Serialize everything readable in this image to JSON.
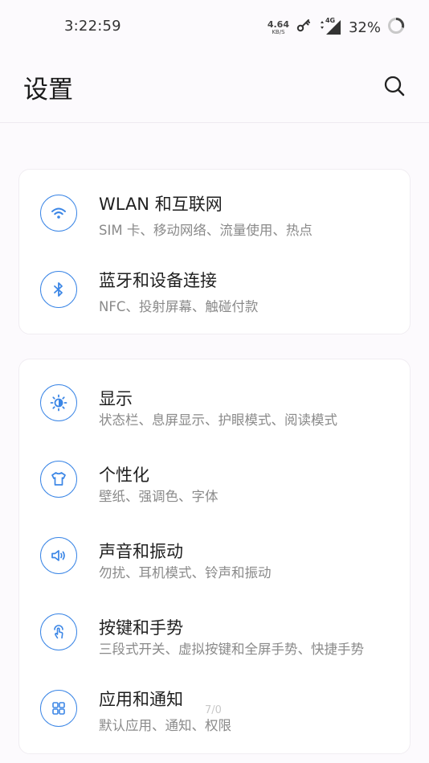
{
  "status_bar": {
    "time": "3:22:59",
    "net_speed_value": "4.64",
    "net_speed_unit": "KB/S",
    "network_type": "4G",
    "battery_percent": "32%"
  },
  "header": {
    "title": "设置"
  },
  "groups": [
    {
      "items": [
        {
          "title": "WLAN 和互联网",
          "subtitle": "SIM 卡、移动网络、流量使用、热点",
          "icon": "wifi-icon"
        },
        {
          "title": "蓝牙和设备连接",
          "subtitle": "NFC、投射屏幕、触碰付款",
          "icon": "bluetooth-icon"
        }
      ]
    },
    {
      "items": [
        {
          "title": "显示",
          "subtitle": "状态栏、息屏显示、护眼模式、阅读模式",
          "icon": "brightness-icon"
        },
        {
          "title": "个性化",
          "subtitle": "壁纸、强调色、字体",
          "icon": "tshirt-icon"
        },
        {
          "title": "声音和振动",
          "subtitle": "勿扰、耳机模式、铃声和振动",
          "icon": "speaker-icon"
        },
        {
          "title": "按键和手势",
          "subtitle": "三段式开关、虚拟按键和全屏手势、快捷手势",
          "icon": "gesture-icon"
        },
        {
          "title": "应用和通知",
          "subtitle": "默认应用、通知、权限",
          "icon": "apps-grid-icon"
        }
      ]
    }
  ],
  "page_indicator": "7/0",
  "colors": {
    "accent": "#3b86e6",
    "background": "#fcfafd",
    "card": "#ffffff",
    "subtitle": "#8a8a8a"
  }
}
